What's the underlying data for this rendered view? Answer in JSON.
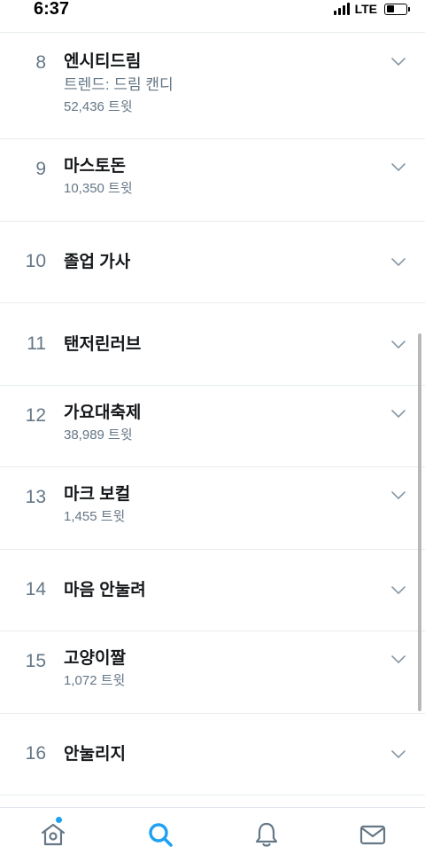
{
  "status_bar": {
    "time": "6:37",
    "network": "LTE",
    "signal_bars": 4,
    "battery_level": 0.4
  },
  "trends": [
    {
      "rank": "8",
      "name": "엔시티드림",
      "context": "트렌드: 드림 캔디",
      "count": "52,436 트윗"
    },
    {
      "rank": "9",
      "name": "마스토돈",
      "count": "10,350 트윗"
    },
    {
      "rank": "10",
      "name": "졸업 가사"
    },
    {
      "rank": "11",
      "name": "탠저린러브"
    },
    {
      "rank": "12",
      "name": "가요대축제",
      "count": "38,989 트윗"
    },
    {
      "rank": "13",
      "name": "마크 보컬",
      "count": "1,455 트윗"
    },
    {
      "rank": "14",
      "name": "마음 안눌려"
    },
    {
      "rank": "15",
      "name": "고양이짤",
      "count": "1,072 트윗"
    },
    {
      "rank": "16",
      "name": "안눌리지"
    }
  ],
  "tab_bar": {
    "tabs": [
      {
        "icon": "home-icon",
        "active": false,
        "has_notification_dot": true
      },
      {
        "icon": "search-icon",
        "active": true
      },
      {
        "icon": "bell-icon",
        "active": false
      },
      {
        "icon": "mail-icon",
        "active": false
      }
    ]
  },
  "colors": {
    "accent": "#1da1f2",
    "primary_text": "#14171a",
    "secondary_text": "#657786",
    "divider": "#e6ecf0",
    "inactive_icon": "#657786"
  }
}
